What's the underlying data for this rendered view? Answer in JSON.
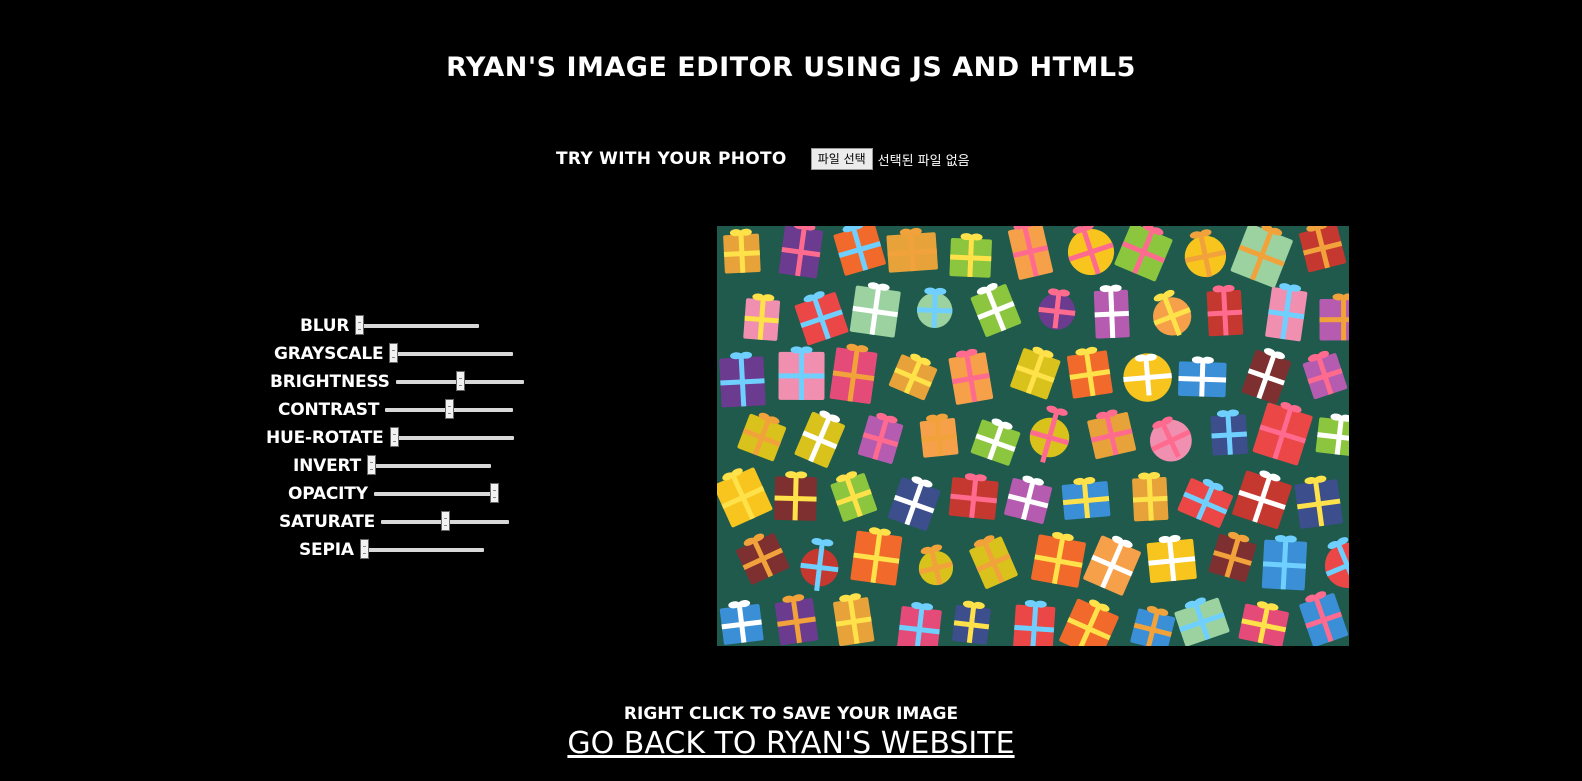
{
  "header": {
    "title": "RYAN'S IMAGE EDITOR USING JS AND HTML5"
  },
  "upload": {
    "label": "TRY WITH YOUR PHOTO",
    "button_label": "파일 선택",
    "status": "선택된 파일 없음"
  },
  "filters": [
    {
      "label": "BLUR",
      "value": 0
    },
    {
      "label": "GRAYSCALE",
      "value": 0
    },
    {
      "label": "BRIGHTNESS",
      "value": 0.5
    },
    {
      "label": "CONTRAST",
      "value": 0.5
    },
    {
      "label": "HUE-ROTATE",
      "value": 0
    },
    {
      "label": "INVERT",
      "value": 0
    },
    {
      "label": "OPACITY",
      "value": 1
    },
    {
      "label": "SATURATE",
      "value": 0.5
    },
    {
      "label": "SEPIA",
      "value": 0
    }
  ],
  "preview": {
    "subject": "gift boxes pattern"
  },
  "footer": {
    "note": "RIGHT CLICK TO SAVE YOUR IMAGE",
    "link_label": "GO BACK TO RYAN'S WEBSITE"
  }
}
